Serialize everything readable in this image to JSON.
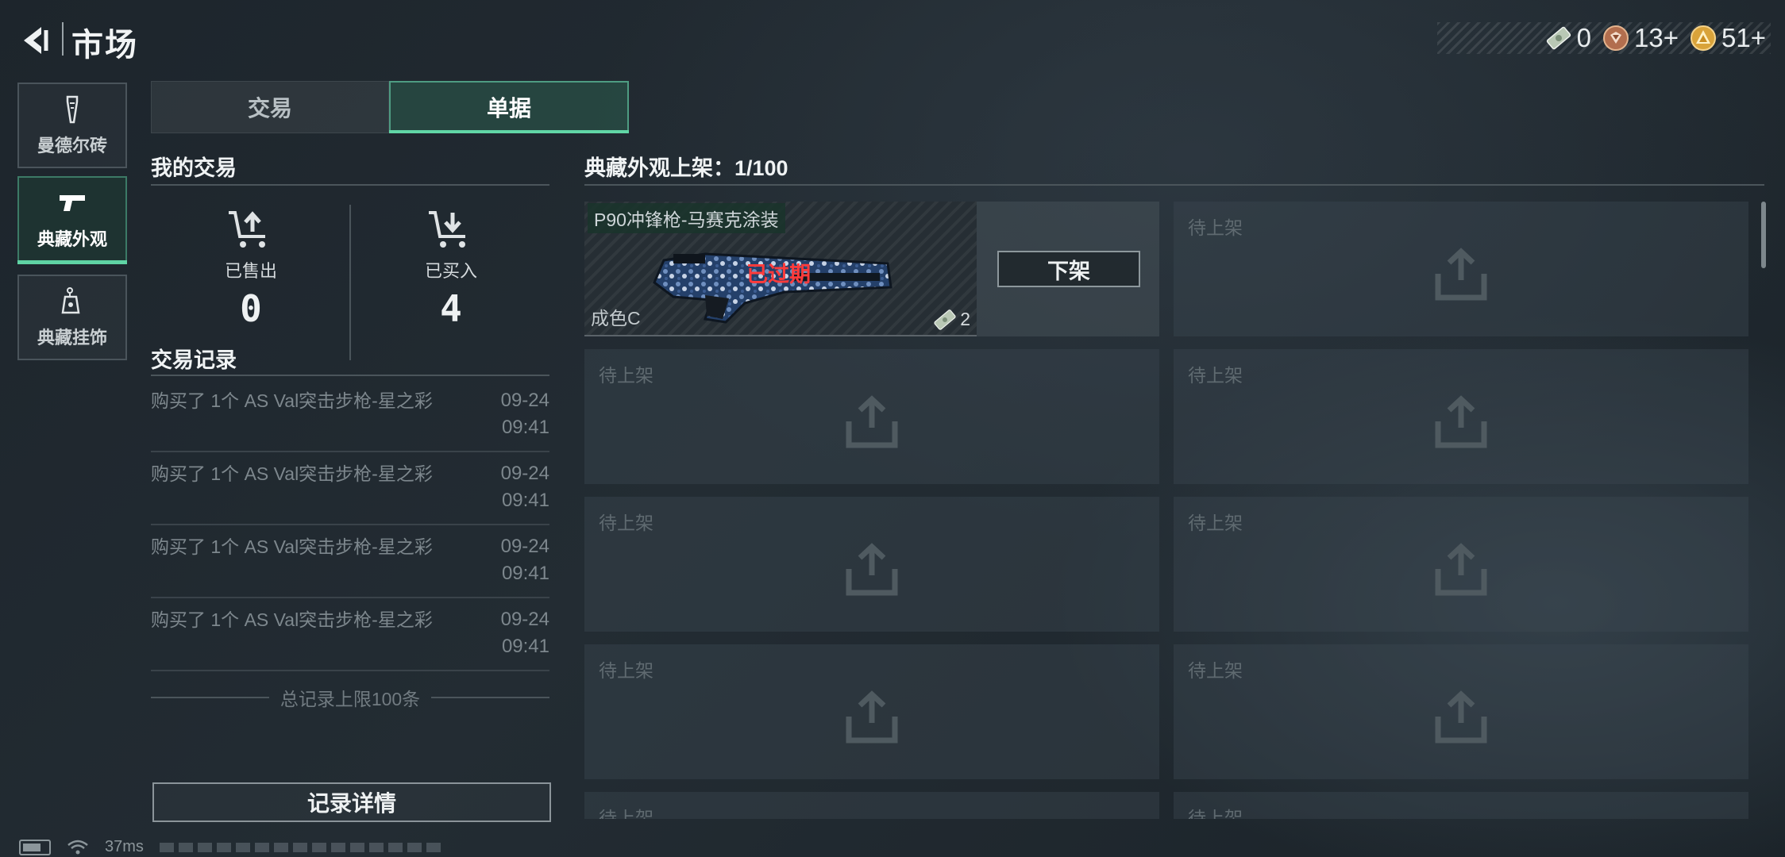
{
  "header": {
    "title": "市场",
    "currencies": [
      {
        "icon": "banknote-icon",
        "value": "0"
      },
      {
        "icon": "medal-icon",
        "value": "13+"
      },
      {
        "icon": "coin-icon",
        "value": "51+"
      }
    ]
  },
  "categories": [
    {
      "label": "曼德尔砖",
      "icon": "brick-icon"
    },
    {
      "label": "典藏外观",
      "icon": "pistol-icon"
    },
    {
      "label": "典藏挂饰",
      "icon": "charm-icon"
    }
  ],
  "tabs": {
    "trade": "交易",
    "orders": "单据"
  },
  "my_trades": {
    "title": "我的交易",
    "sold_label": "已售出",
    "sold_value": "0",
    "bought_label": "已买入",
    "bought_value": "4"
  },
  "records": {
    "title": "交易记录",
    "items": [
      {
        "text": "购买了 1个 AS Val突击步枪-星之彩",
        "date": "09-24",
        "time": "09:41"
      },
      {
        "text": "购买了 1个 AS Val突击步枪-星之彩",
        "date": "09-24",
        "time": "09:41"
      },
      {
        "text": "购买了 1个 AS Val突击步枪-星之彩",
        "date": "09-24",
        "time": "09:41"
      },
      {
        "text": "购买了 1个 AS Val突击步枪-星之彩",
        "date": "09-24",
        "time": "09:41"
      }
    ],
    "limit_text": "总记录上限100条",
    "detail_button": "记录详情"
  },
  "listings": {
    "title": "典藏外观上架：1/100",
    "item": {
      "name": "P90冲锋枪-马赛克涂装",
      "status": "已过期",
      "grade": "成色C",
      "count": "2",
      "delist_button": "下架"
    },
    "placeholder_label": "待上架"
  },
  "statusbar": {
    "latency": "37ms"
  },
  "colors": {
    "accent": "#5fd3a4",
    "expired": "#ff3b3b"
  }
}
